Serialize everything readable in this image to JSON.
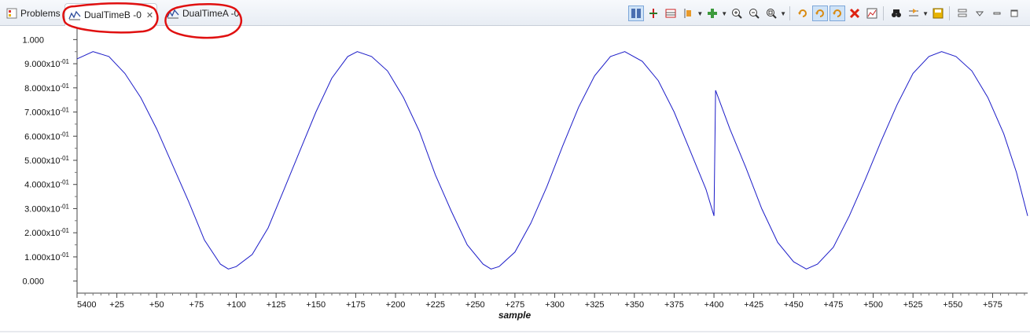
{
  "tabs": [
    {
      "label": "Problems",
      "active": false
    },
    {
      "label": "DualTimeB -0",
      "active": true,
      "close_icon": "close-icon"
    },
    {
      "label": "DualTimeA -0",
      "active": false
    }
  ],
  "toolbar_icons": [
    "align-panels-icon",
    "cursor-icon",
    "data-table-icon",
    "scale-icon",
    "add-measurement-icon",
    "zoom-in-icon",
    "zoom-out-icon",
    "zoom-fit-icon",
    "refresh-icon",
    "continuous-refresh-icon",
    "auto-refresh-icon",
    "clear-icon",
    "export-icon",
    "binoculars-icon",
    "graph-settings-icon",
    "save-icon",
    "view-menu-icon",
    "minimize-icon",
    "maximize-icon"
  ],
  "colors": {
    "series": "#1c1cc8",
    "annotation": "#e01010",
    "grid_bg": "#ffffff"
  },
  "chart_data": {
    "type": "line",
    "title": "",
    "xlabel": "sample",
    "ylabel": "",
    "x_start_label": "5400",
    "x_tick_labels": [
      "5400",
      "+25",
      "+50",
      "+75",
      "+100",
      "+125",
      "+150",
      "+175",
      "+200",
      "+225",
      "+250",
      "+275",
      "+300",
      "+325",
      "+350",
      "+375",
      "+400",
      "+425",
      "+450",
      "+475",
      "+500",
      "+525",
      "+550",
      "+575"
    ],
    "y_tick_labels": [
      "0.000",
      "1.000x10",
      "2.000x10",
      "3.000x10",
      "4.000x10",
      "5.000x10",
      "6.000x10",
      "7.000x10",
      "8.000x10",
      "9.000x10",
      "1.000"
    ],
    "y_tick_exponent": "-01",
    "xlim": [
      0,
      597
    ],
    "ylim": [
      -0.05,
      1.05
    ],
    "series": [
      {
        "points": [
          [
            0,
            0.92
          ],
          [
            10,
            0.95
          ],
          [
            20,
            0.93
          ],
          [
            30,
            0.86
          ],
          [
            40,
            0.76
          ],
          [
            50,
            0.63
          ],
          [
            60,
            0.48
          ],
          [
            70,
            0.33
          ],
          [
            80,
            0.17
          ],
          [
            90,
            0.07
          ],
          [
            95,
            0.05
          ],
          [
            100,
            0.06
          ],
          [
            110,
            0.11
          ],
          [
            120,
            0.22
          ],
          [
            130,
            0.38
          ],
          [
            140,
            0.54
          ],
          [
            150,
            0.7
          ],
          [
            160,
            0.84
          ],
          [
            170,
            0.93
          ],
          [
            176,
            0.95
          ],
          [
            185,
            0.93
          ],
          [
            195,
            0.87
          ],
          [
            205,
            0.76
          ],
          [
            215,
            0.62
          ],
          [
            225,
            0.44
          ],
          [
            235,
            0.29
          ],
          [
            245,
            0.15
          ],
          [
            255,
            0.07
          ],
          [
            260,
            0.05
          ],
          [
            265,
            0.06
          ],
          [
            275,
            0.12
          ],
          [
            285,
            0.24
          ],
          [
            295,
            0.39
          ],
          [
            305,
            0.56
          ],
          [
            315,
            0.72
          ],
          [
            325,
            0.85
          ],
          [
            335,
            0.93
          ],
          [
            344,
            0.95
          ],
          [
            355,
            0.91
          ],
          [
            365,
            0.83
          ],
          [
            375,
            0.7
          ],
          [
            385,
            0.54
          ],
          [
            395,
            0.38
          ],
          [
            400,
            0.27
          ],
          [
            401,
            0.79
          ],
          [
            410,
            0.63
          ],
          [
            420,
            0.47
          ],
          [
            430,
            0.3
          ],
          [
            440,
            0.16
          ],
          [
            450,
            0.08
          ],
          [
            458,
            0.05
          ],
          [
            465,
            0.07
          ],
          [
            475,
            0.14
          ],
          [
            485,
            0.27
          ],
          [
            495,
            0.42
          ],
          [
            505,
            0.58
          ],
          [
            515,
            0.73
          ],
          [
            525,
            0.86
          ],
          [
            535,
            0.93
          ],
          [
            543,
            0.95
          ],
          [
            552,
            0.93
          ],
          [
            562,
            0.87
          ],
          [
            572,
            0.76
          ],
          [
            582,
            0.61
          ],
          [
            590,
            0.45
          ],
          [
            597,
            0.27
          ]
        ]
      }
    ]
  }
}
